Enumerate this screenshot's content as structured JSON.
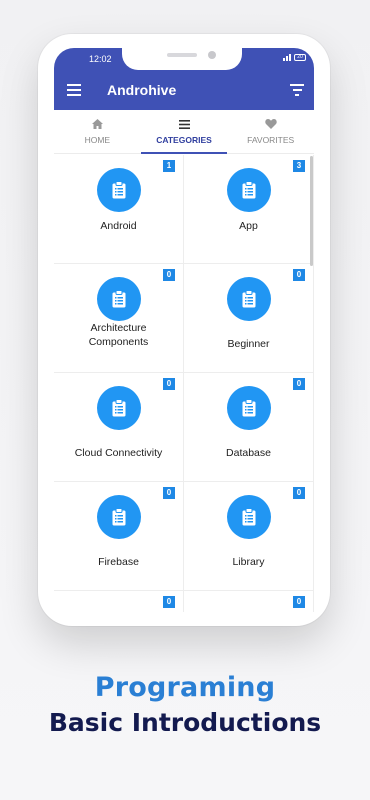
{
  "status": {
    "time": "12:02",
    "battery": "20"
  },
  "appbar": {
    "title": "Androhive"
  },
  "tabs": [
    {
      "label": "HOME",
      "icon": "home-icon",
      "active": false
    },
    {
      "label": "CATEGORIES",
      "icon": "list-icon",
      "active": true
    },
    {
      "label": "FAVORITES",
      "icon": "heart-icon",
      "active": false
    }
  ],
  "categories": [
    {
      "label": "Android",
      "count": "1"
    },
    {
      "label": "App",
      "count": "3"
    },
    {
      "label": "Architecture Components",
      "count": "0"
    },
    {
      "label": "Beginner",
      "count": "0"
    },
    {
      "label": "Cloud Connectivity",
      "count": "0"
    },
    {
      "label": "Database",
      "count": "0"
    },
    {
      "label": "Firebase",
      "count": "0"
    },
    {
      "label": "Library",
      "count": "0"
    },
    {
      "label": "",
      "count": "0"
    },
    {
      "label": "",
      "count": "0"
    }
  ],
  "promo": {
    "headline": "Programing",
    "subline": "Basic Introductions"
  },
  "colors": {
    "primary": "#3f51b5",
    "accent": "#2196f3",
    "badge": "#1e88e5",
    "headline": "#2a7fd4",
    "subline": "#131a4f"
  }
}
